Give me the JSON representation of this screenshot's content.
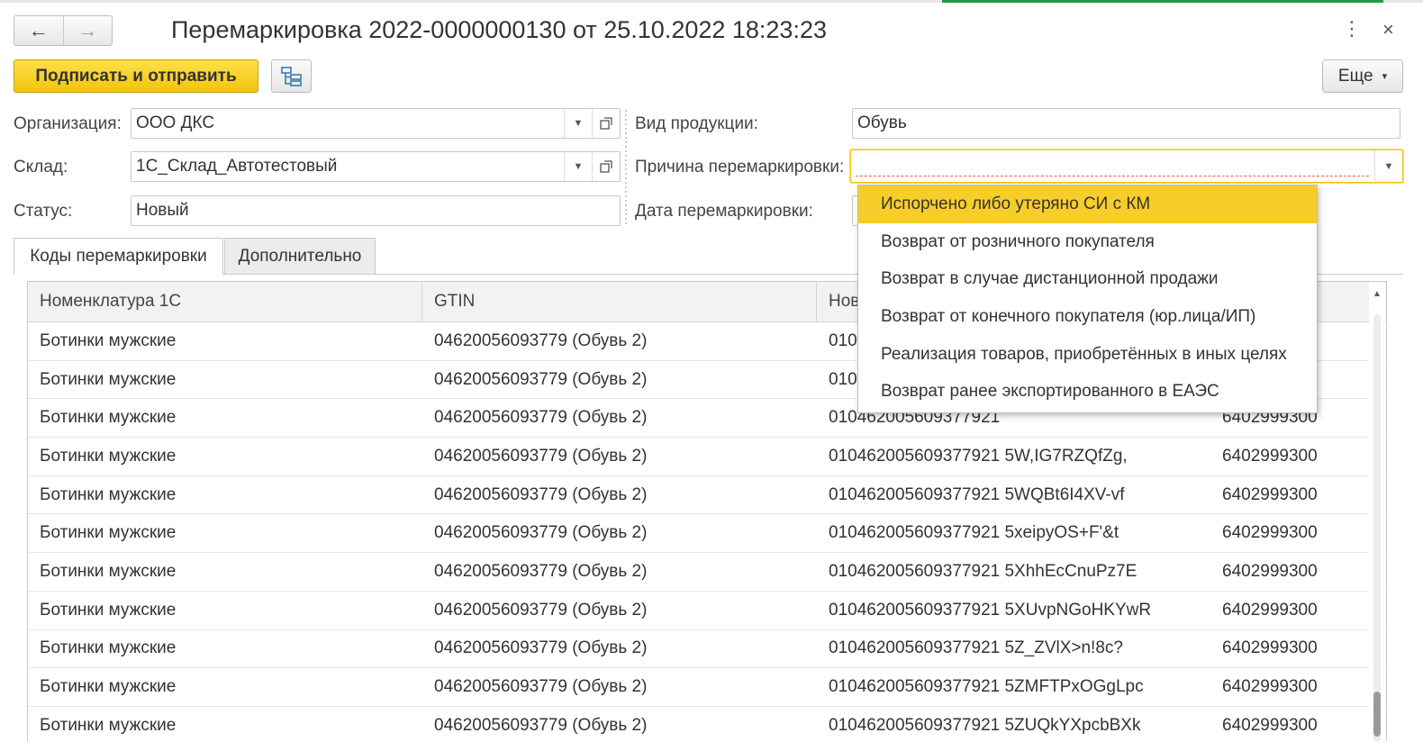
{
  "window": {
    "title": "Перемаркировка 2022-0000000130 от 25.10.2022 18:23:23",
    "back_icon": "←",
    "forward_icon": "→",
    "more_icon": "⋮",
    "close_icon": "×"
  },
  "toolbar": {
    "sign_send_label": "Подписать и отправить",
    "more_label": "Еще",
    "more_arrow": "▾"
  },
  "form": {
    "organization": {
      "label": "Организация:",
      "value": "ООО ДКС"
    },
    "warehouse": {
      "label": "Склад:",
      "value": "1С_Склад_Автотестовый"
    },
    "status": {
      "label": "Статус:",
      "value": "Новый"
    },
    "product_type": {
      "label": "Вид продукции:",
      "value": "Обувь"
    },
    "reason": {
      "label": "Причина перемаркировки:",
      "value": ""
    },
    "remark_date": {
      "label": "Дата перемаркировки:",
      "value": ""
    }
  },
  "tabs": [
    {
      "label": "Коды перемаркировки",
      "active": true
    },
    {
      "label": "Дополнительно",
      "active": false
    }
  ],
  "table": {
    "columns": [
      "Номенклатура 1С",
      "GTIN",
      "Нов",
      ""
    ],
    "rows": [
      [
        "Ботинки мужские",
        "04620056093779 (Обувь 2)",
        "010",
        ""
      ],
      [
        "Ботинки мужские",
        "04620056093779 (Обувь 2)",
        "010",
        ""
      ],
      [
        "Ботинки мужские",
        "04620056093779 (Обувь 2)",
        "010462005609377921",
        "6402999300"
      ],
      [
        "Ботинки мужские",
        "04620056093779 (Обувь 2)",
        "010462005609377921 5W,IG7RZQfZg,",
        "6402999300"
      ],
      [
        "Ботинки мужские",
        "04620056093779 (Обувь 2)",
        "010462005609377921 5WQBt6I4XV-vf",
        "6402999300"
      ],
      [
        "Ботинки мужские",
        "04620056093779 (Обувь 2)",
        "010462005609377921 5xeipyOS+F'&t",
        "6402999300"
      ],
      [
        "Ботинки мужские",
        "04620056093779 (Обувь 2)",
        "010462005609377921 5XhhEcCnuPz7E",
        "6402999300"
      ],
      [
        "Ботинки мужские",
        "04620056093779 (Обувь 2)",
        "010462005609377921 5XUvpNGoHKYwR",
        "6402999300"
      ],
      [
        "Ботинки мужские",
        "04620056093779 (Обувь 2)",
        "010462005609377921 5Z_ZVlX>n!8c?",
        "6402999300"
      ],
      [
        "Ботинки мужские",
        "04620056093779 (Обувь 2)",
        "010462005609377921 5ZMFTPxOGgLpc",
        "6402999300"
      ],
      [
        "Ботинки мужские",
        "04620056093779 (Обувь 2)",
        "010462005609377921 5ZUQkYXpcbBXk",
        "6402999300"
      ]
    ]
  },
  "dropdown": {
    "items": [
      "Испорчено либо утеряно СИ с КМ",
      "Возврат от розничного покупателя",
      "Возврат в случае дистанционной продажи",
      "Возврат от конечного покупателя (юр.лица/ИП)",
      "Реализация товаров, приобретённых в иных целях",
      "Возврат ранее экспортированного в ЕАЭС"
    ],
    "selected_index": 0
  },
  "colors": {
    "accent": "#f7cd2a",
    "tab_inactive": "#ececec",
    "header_bg": "#f2f2f2"
  }
}
